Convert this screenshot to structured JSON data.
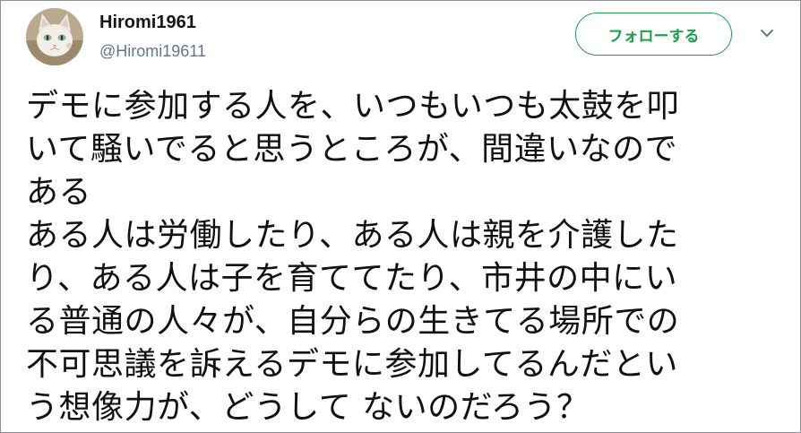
{
  "user": {
    "display_name": "Hiromi1961",
    "handle": "@Hiromi19611",
    "avatar_icon": "cat-avatar"
  },
  "actions": {
    "follow_label": "フォローする",
    "menu_icon": "chevron-down-icon"
  },
  "tweet": {
    "lines": [
      "デモに参加する人を、いつもいつも太鼓を叩",
      "いて騒いでると思うところが、間違いなので",
      "ある",
      "ある人は労働したり、ある人は親を介護した",
      "り、ある人は子を育ててたり、市井の中にい",
      "る普通の人々が、自分らの生きてる場所での",
      "不可思議を訴えるデモに参加してるんだとい",
      "う想像力が、どうして ないのだろう？"
    ]
  },
  "colors": {
    "follow_accent": "#1e9e4a",
    "handle_gray": "#657786",
    "text": "#111111"
  }
}
